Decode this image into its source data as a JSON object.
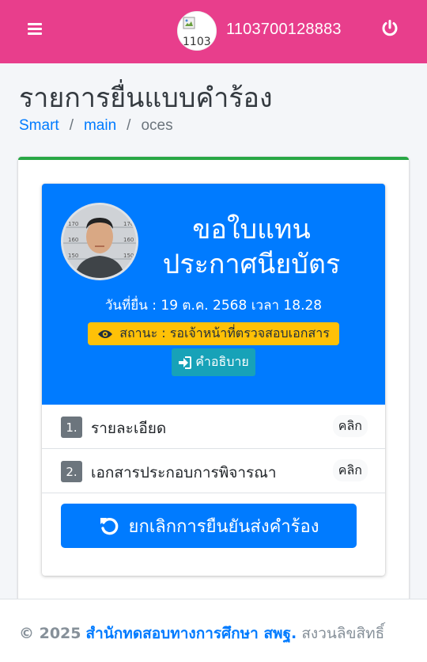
{
  "navbar": {
    "menu_icon": "bars-icon",
    "avatar_alt": "1103",
    "username": "1103700128883",
    "power_icon": "power-off-icon",
    "color": "#e83e8c"
  },
  "page": {
    "title": "รายการยื่นแบบคำร้อง",
    "breadcrumb": [
      "Smart",
      "main",
      "oces"
    ]
  },
  "widget": {
    "title_line1": "ขอใบแทน",
    "title_line2": "ประกาศนียบัตร",
    "submit_date": "วันที่ยื่น : 19 ต.ค. 2568 เวลา 18.28",
    "status": "สถานะ : รอเจ้าหน้าที่ตรวจสอบเอกสาร",
    "status_icon": "eye-icon",
    "description_button": "คำอธิบาย",
    "description_icon": "sign-in-icon",
    "header_color": "#007bff",
    "status_color": "#ffc107"
  },
  "list": [
    {
      "number": "1.",
      "label": "รายละเอียด",
      "action": "คลิก"
    },
    {
      "number": "2.",
      "label": "เอกสารประกอบการพิจารณา",
      "action": "คลิก"
    }
  ],
  "cancel_button": {
    "label": "ยกเลิกการยืนยันส่งคำร้อง",
    "icon": "undo-icon"
  },
  "footer": {
    "copyright": "© 2025",
    "org": "สำนักทดสอบทางการศึกษา สพฐ.",
    "rights": "สงวนลิขสิทธิ์"
  }
}
